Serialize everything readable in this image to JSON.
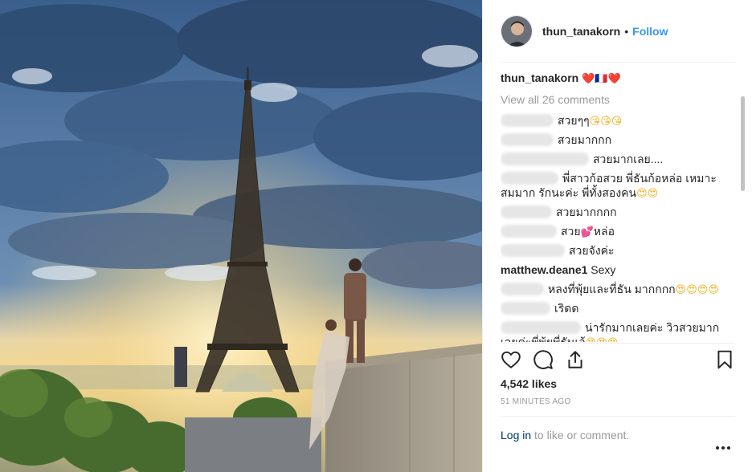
{
  "post": {
    "username": "thun_tanakorn",
    "follow_label": "Follow",
    "caption": "❤️🇫🇷❤️",
    "view_all_label": "View all 26 comments",
    "likes": "4,542 likes",
    "timestamp": "51 MINUTES AGO",
    "login_link": "Log in",
    "login_suffix": "to like or comment."
  },
  "comments": [
    {
      "text": "สวยๆๆ",
      "emoji": "😘😘😘"
    },
    {
      "text": "สวยมากกก",
      "emoji": ""
    },
    {
      "text": "สวยมากเลย....",
      "emoji": ""
    },
    {
      "text": "พี่สาวก้อสวย พี่ธันก้อหล่อ เหมาะ",
      "line2": "สมมาก รักนะค่ะ พี่ทั้งสองคน",
      "emoji": "😍😍"
    },
    {
      "text": "สวยมากกกก",
      "emoji": ""
    },
    {
      "text": "สวย",
      "emoji": "💕",
      "suffix": "หล่อ"
    },
    {
      "text": "สวยจังค่ะ",
      "emoji": ""
    },
    {
      "user": "matthew.deane1",
      "text": "Sexy",
      "emoji": ""
    },
    {
      "text": "หลงที่พุ้ยและที่ธัน มากกกก",
      "emoji": "😍😍😍😍"
    },
    {
      "text": "เริดด",
      "emoji": ""
    },
    {
      "text": "น่ารักมากเลยค่ะ วิวสวยมาก",
      "line2": "เลยค่ะพี่พุ้ยพี่ธันเอ้",
      "emoji": "😍😍😍"
    }
  ],
  "icons": {
    "like": "heart-outline-icon",
    "comment": "speech-bubble-icon",
    "share": "share-upload-icon",
    "save": "bookmark-icon",
    "more": "ellipsis-icon"
  },
  "colors": {
    "link": "#3897f0",
    "text": "#262626",
    "muted": "#999999",
    "login_link": "#003569"
  }
}
